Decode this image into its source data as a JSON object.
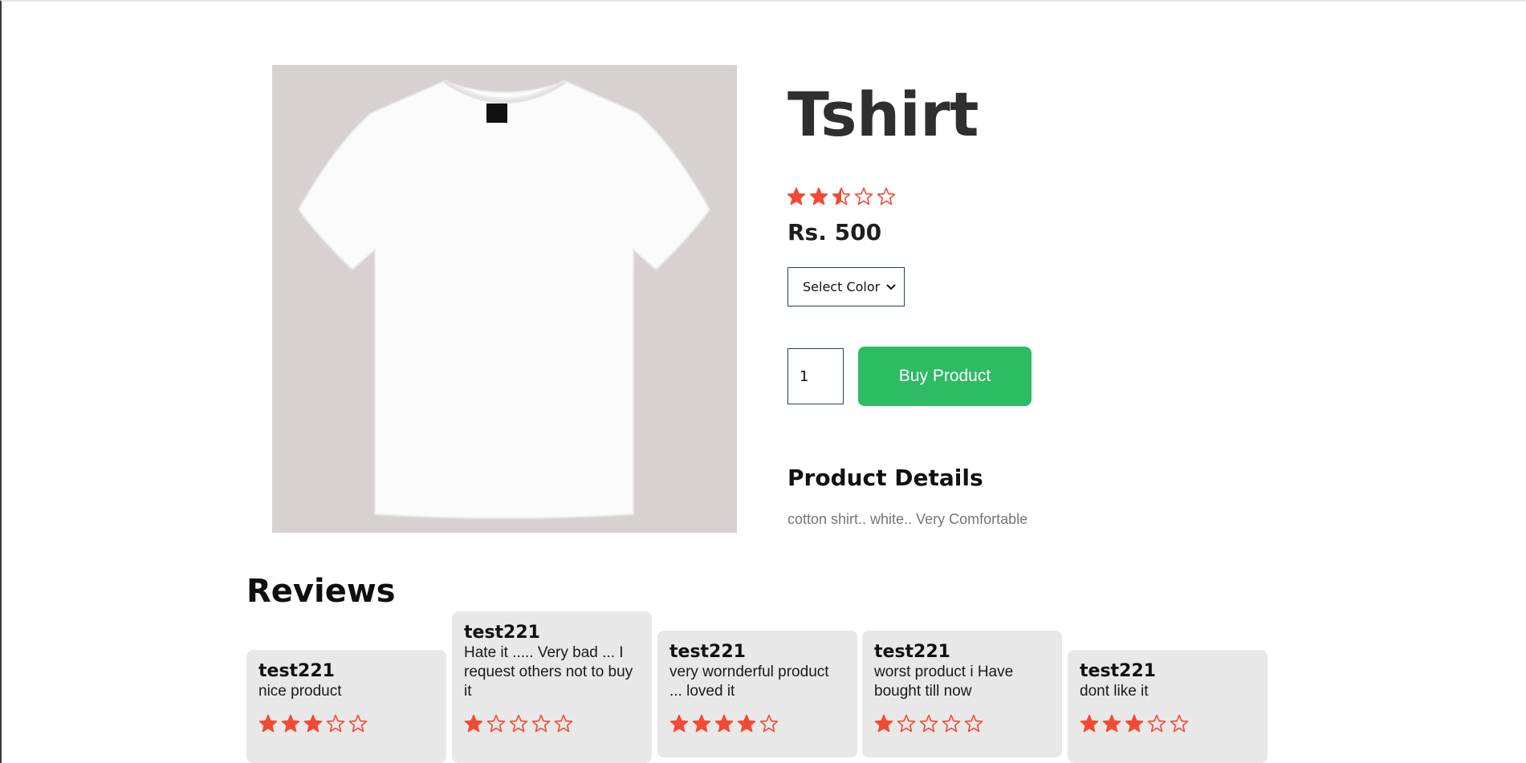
{
  "product": {
    "title": "Tshirt",
    "rating": 2.5,
    "rating_max": 5,
    "price": "Rs. 500",
    "color_select": {
      "selected_label": "Select Color"
    },
    "quantity": "1",
    "buy_label": "Buy Product",
    "details_heading": "Product Details",
    "details_text": "cotton shirt.. white.. Very Comfortable",
    "image_icon": "tshirt-image"
  },
  "reviews": {
    "heading": "Reviews",
    "items": [
      {
        "user": "test221",
        "text": "nice product",
        "rating": 3
      },
      {
        "user": "test221",
        "text": "Hate it ..... Very bad ... I request others not to buy it",
        "rating": 1
      },
      {
        "user": "test221",
        "text": "very wornderful product ... loved it",
        "rating": 4
      },
      {
        "user": "test221",
        "text": "worst product i Have bought till now",
        "rating": 1
      },
      {
        "user": "test221",
        "text": "dont like it",
        "rating": 3
      }
    ]
  },
  "colors": {
    "star": "#f44a34",
    "buy_button": "#2dbb63",
    "image_bg": "#d7d1d1",
    "review_card_bg": "#e8e8e8"
  }
}
